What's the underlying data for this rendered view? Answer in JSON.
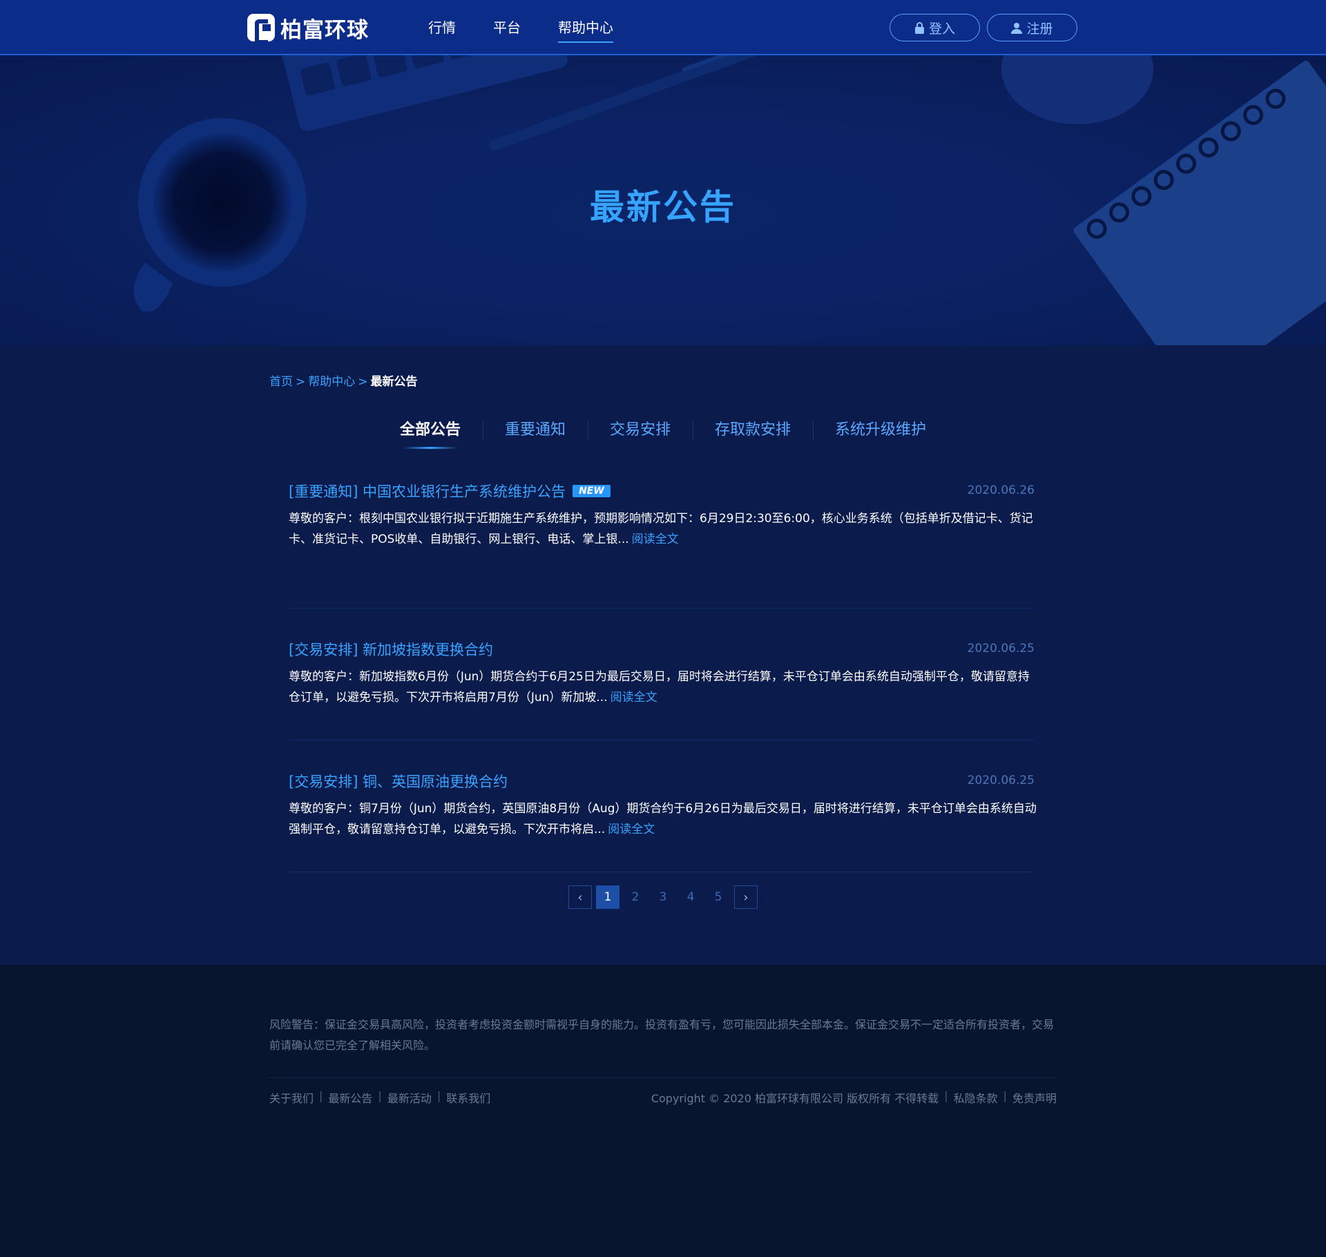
{
  "header": {
    "logo_text": "柏富环球",
    "nav": [
      "行情",
      "平台",
      "帮助中心"
    ],
    "active_nav": "帮助中心",
    "login_label": "登入",
    "register_label": "注册"
  },
  "hero": {
    "title": "最新公告"
  },
  "breadcrumb": {
    "home": "首页",
    "sep1": ">",
    "help": "帮助中心",
    "sep2": ">",
    "current": "最新公告"
  },
  "tabs": [
    "全部公告",
    "重要通知",
    "交易安排",
    "存取款安排",
    "系统升级维护"
  ],
  "active_tab": "全部公告",
  "notices": [
    {
      "title": "[重要通知] 中国农业银行生产系统维护公告",
      "badge": "NEW",
      "date": "2020.06.26",
      "body": "尊敬的客户：根刻中国农业银行拟于近期施生产系统维护，预期影响情况如下：6月29日2:30至6:00，核心业务系统（包括单折及借记卡、货记卡、准货记卡、POS收单、自助银行、网上银行、电话、掌上银...",
      "read_more": "阅读全文"
    },
    {
      "title": "[交易安排] 新加坡指数更换合约",
      "date": "2020.06.25",
      "body": "尊敬的客户：新加坡指数6月份（Jun）期货合约于6月25日为最后交易日，届时将会进行结算，未平仓订单会由系统自动强制平仓，敬请留意持仓订单，以避免亏损。下次开市将启用7月份（Jun）新加坡...",
      "read_more": "阅读全文"
    },
    {
      "title": "[交易安排] 铜、英国原油更换合约",
      "date": "2020.06.25",
      "body": "尊敬的客户：铜7月份（Jun）期货合约，英国原油8月份（Aug）期货合约于6月26日为最后交易日，届时将进行结算，未平仓订单会由系统自动强制平仓，敬请留意持仓订单，以避免亏损。下次开市将启...",
      "read_more": "阅读全文"
    }
  ],
  "pagination": {
    "prev": "‹",
    "pages": [
      "1",
      "2",
      "3",
      "4",
      "5"
    ],
    "current": "1",
    "next": "›"
  },
  "footer": {
    "risk_warning": "风险警告：保证金交易具高风险，投资者考虑投资金额时需视乎自身的能力。投资有盈有亏，您可能因此损失全部本金。保证金交易不一定适合所有投资者，交易前请确认您已完全了解相关风险。",
    "links": [
      "关于我们",
      "最新公告",
      "最新活动",
      "联系我们"
    ],
    "separator": "|",
    "copyright": "Copyright © 2020 柏富环球有限公司 版权所有 不得转载",
    "privacy": "私隐条款",
    "disclaimer": "免责声明"
  },
  "colors": {
    "header_bg": "#0c2c8a",
    "accent": "#3aa2ff",
    "main_bg": "#0b1b4b",
    "footer_bg": "#07162e"
  },
  "icons": {
    "login": "lock-icon",
    "register": "user-icon",
    "prev": "chevron-left-icon",
    "next": "chevron-right-icon"
  }
}
